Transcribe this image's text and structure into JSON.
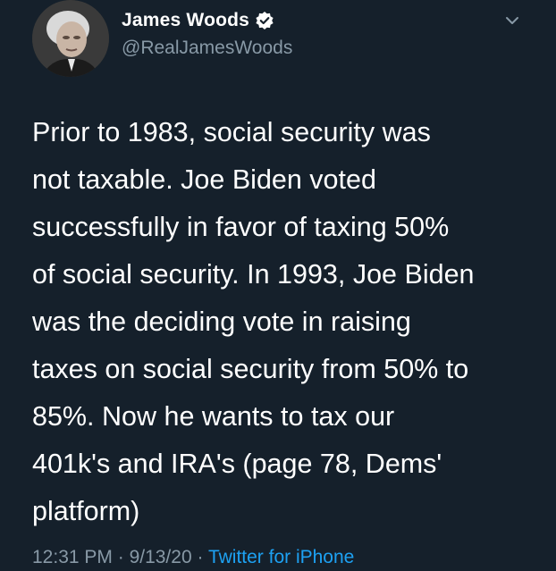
{
  "tweet": {
    "author": {
      "display_name": "James Woods",
      "handle": "@RealJamesWoods",
      "verified_icon": "verified-badge-icon",
      "avatar_icon": "profile-photo"
    },
    "menu_icon": "chevron-down-icon",
    "text": "Prior to 1983, social security was\nnot taxable. Joe Biden voted\nsuccessfully in favor of taxing 50%\nof social security. In 1993, Joe Biden\nwas the deciding vote in raising\ntaxes on social security from 50% to\n85%. Now he wants to tax our\n401k's and IRA's (page 78, Dems'\nplatform)",
    "time": "12:31 PM",
    "separator": " · ",
    "date": "9/13/20",
    "source": "Twitter for iPhone"
  },
  "colors": {
    "background": "#15202b",
    "text": "#ffffff",
    "secondary_text": "#8899a6",
    "accent": "#1da1f2"
  }
}
